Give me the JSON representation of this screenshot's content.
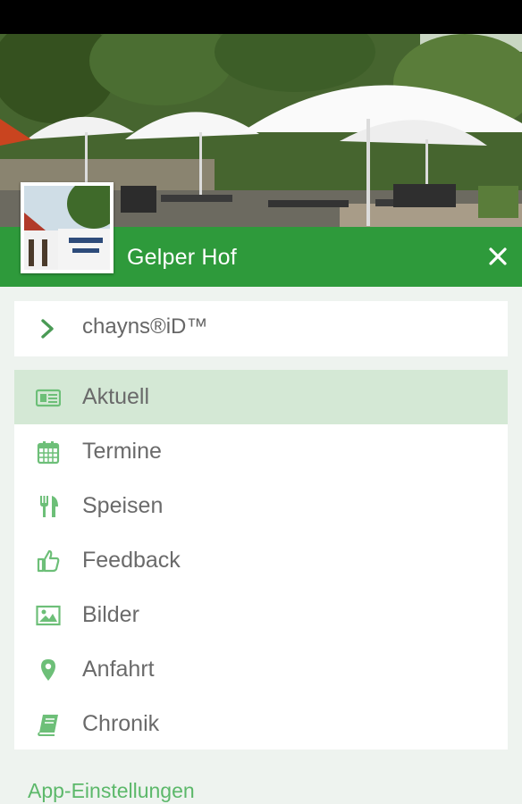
{
  "app": {
    "title": "Gelper Hof"
  },
  "header": {
    "avatar_icon": "restaurant-sign-photo",
    "close_icon": "close-icon"
  },
  "id_item": {
    "label": "chayns®iD™",
    "icon": "chevron-right-icon"
  },
  "menu": {
    "items": [
      {
        "label": "Aktuell",
        "icon": "newspaper-icon",
        "active": true
      },
      {
        "label": "Termine",
        "icon": "calendar-icon",
        "active": false
      },
      {
        "label": "Speisen",
        "icon": "cutlery-icon",
        "active": false
      },
      {
        "label": "Feedback",
        "icon": "thumbs-up-icon",
        "active": false
      },
      {
        "label": "Bilder",
        "icon": "image-icon",
        "active": false
      },
      {
        "label": "Anfahrt",
        "icon": "map-pin-icon",
        "active": false
      },
      {
        "label": "Chronik",
        "icon": "book-icon",
        "active": false
      }
    ]
  },
  "footer": {
    "settings_label": "App-Einstellungen"
  },
  "colors": {
    "primary": "#2e9a3b",
    "active_item": "#d4e8d5",
    "icon": "#6dbf78",
    "link": "#5cb86a"
  }
}
